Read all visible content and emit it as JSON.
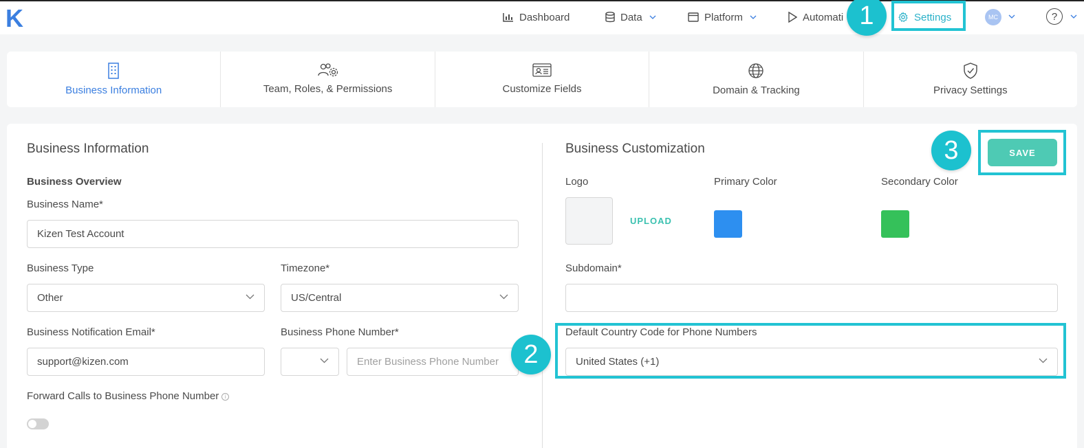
{
  "app": {
    "logo_letter": "K"
  },
  "nav": {
    "dashboard": "Dashboard",
    "data": "Data",
    "platform": "Platform",
    "automations": "Automati",
    "settings": "Settings",
    "avatar_initials": "MC",
    "help": "?"
  },
  "tabs": [
    {
      "label": "Business Information",
      "icon": "building-icon"
    },
    {
      "label": "Team, Roles, & Permissions",
      "icon": "team-gear-icon"
    },
    {
      "label": "Customize Fields",
      "icon": "id-card-icon"
    },
    {
      "label": "Domain & Tracking",
      "icon": "globe-icon"
    },
    {
      "label": "Privacy Settings",
      "icon": "shield-check-icon"
    }
  ],
  "left": {
    "title": "Business Information",
    "overview": "Business Overview",
    "name_label": "Business Name*",
    "name_value": "Kizen Test Account",
    "type_label": "Business Type",
    "type_value": "Other",
    "timezone_label": "Timezone*",
    "timezone_value": "US/Central",
    "email_label": "Business Notification Email*",
    "email_value": "support@kizen.com",
    "phone_label": "Business Phone Number*",
    "phone_placeholder": "Enter Business Phone Number",
    "forward_label": "Forward Calls to Business Phone Number",
    "info_glyph": "i"
  },
  "right": {
    "title": "Business Customization",
    "save_label": "SAVE",
    "logo_label": "Logo",
    "upload_label": "UPLOAD",
    "primary_label": "Primary Color",
    "secondary_label": "Secondary Color",
    "primary_color": "#2d8ff0",
    "secondary_color": "#35c15a",
    "subdomain_label": "Subdomain*",
    "subdomain_value": "",
    "country_label": "Default Country Code for Phone Numbers",
    "country_value": "United States (+1)"
  },
  "callouts": [
    "1",
    "2",
    "3"
  ]
}
